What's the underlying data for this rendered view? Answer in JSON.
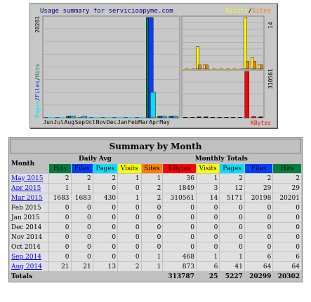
{
  "chart": {
    "title": "Usage summary for servicioapyme.com",
    "legend_visits": "Visits",
    "legend_sep": "/",
    "legend_sites": "Sites",
    "left_scale_max": "20201",
    "right_scale_max": "14",
    "right_lower_scale_max": "310561",
    "left_axis_pages": "Pages",
    "left_axis_files": "Files",
    "left_axis_hits": "Hits",
    "axis_sep": "/",
    "kbytes_label": "KBytes",
    "months": [
      "Jun",
      "Jul",
      "Aug",
      "Sep",
      "Oct",
      "Nov",
      "Dec",
      "Jan",
      "Feb",
      "Mar",
      "Apr",
      "May"
    ],
    "colors": {
      "hits": "#008040",
      "files": "#0040ff",
      "pages": "#00e0ff",
      "visits": "#ffff00",
      "sites": "#ff8000",
      "kbytes": "#ff0000"
    }
  },
  "chart_data": {
    "type": "bar",
    "title": "Usage summary for servicioapyme.com",
    "categories": [
      "Jun",
      "Jul",
      "Aug",
      "Sep",
      "Oct",
      "Nov",
      "Dec",
      "Jan",
      "Feb",
      "Mar",
      "Apr",
      "May"
    ],
    "series": [
      {
        "name": "Hits",
        "values": [
          0,
          0,
          6,
          0,
          0,
          0,
          0,
          0,
          0,
          20201,
          29,
          2
        ]
      },
      {
        "name": "Files",
        "values": [
          0,
          0,
          6,
          0,
          0,
          0,
          0,
          0,
          0,
          20198,
          29,
          2
        ]
      },
      {
        "name": "Pages",
        "values": [
          0,
          0,
          6,
          1,
          0,
          0,
          0,
          0,
          0,
          5171,
          12,
          2
        ]
      },
      {
        "name": "Visits",
        "values": [
          0,
          0,
          6,
          1,
          0,
          0,
          0,
          0,
          0,
          14,
          3,
          1
        ]
      },
      {
        "name": "Sites",
        "values": [
          0,
          0,
          1,
          1,
          0,
          0,
          0,
          0,
          0,
          2,
          2,
          1
        ]
      },
      {
        "name": "KBytes",
        "values": [
          0,
          0,
          873,
          468,
          0,
          0,
          0,
          0,
          0,
          310561,
          1849,
          36
        ]
      }
    ],
    "ylim_hits": [
      0,
      20201
    ],
    "ylim_visits": [
      0,
      14
    ],
    "ylim_kbytes": [
      0,
      310561
    ]
  },
  "table": {
    "title": "Summary by Month",
    "month_header": "Month",
    "daily_avg_header": "Daily Avg",
    "monthly_totals_header": "Monthly Totals",
    "daily_cols": [
      {
        "label": "Hits",
        "color": "#008040"
      },
      {
        "label": "Files",
        "color": "#0040ff"
      },
      {
        "label": "Pages",
        "color": "#00e0ff"
      },
      {
        "label": "Visits",
        "color": "#ffff00"
      }
    ],
    "monthly_cols": [
      {
        "label": "Sites",
        "color": "#ff8000"
      },
      {
        "label": "KBytes",
        "color": "#ff0000"
      },
      {
        "label": "Visits",
        "color": "#ffff00"
      },
      {
        "label": "Pages",
        "color": "#00e0ff"
      },
      {
        "label": "Files",
        "color": "#0040ff"
      },
      {
        "label": "Hits",
        "color": "#008040"
      }
    ],
    "rows": [
      {
        "month": "May 2015",
        "link": true,
        "v": [
          "2",
          "2",
          "2",
          "1",
          "1",
          "36",
          "1",
          "2",
          "2",
          "2"
        ]
      },
      {
        "month": "Apr 2015",
        "link": true,
        "v": [
          "1",
          "1",
          "0",
          "0",
          "2",
          "1849",
          "3",
          "12",
          "29",
          "29"
        ]
      },
      {
        "month": "Mar 2015",
        "link": true,
        "v": [
          "1683",
          "1683",
          "430",
          "1",
          "2",
          "310561",
          "14",
          "5171",
          "20198",
          "20201"
        ]
      },
      {
        "month": "Feb 2015",
        "link": false,
        "v": [
          "0",
          "0",
          "0",
          "0",
          "0",
          "0",
          "0",
          "0",
          "0",
          "0"
        ]
      },
      {
        "month": "Jan 2015",
        "link": false,
        "v": [
          "0",
          "0",
          "0",
          "0",
          "0",
          "0",
          "0",
          "0",
          "0",
          "0"
        ]
      },
      {
        "month": "Dec 2014",
        "link": false,
        "v": [
          "0",
          "0",
          "0",
          "0",
          "0",
          "0",
          "0",
          "0",
          "0",
          "0"
        ]
      },
      {
        "month": "Nov 2014",
        "link": false,
        "v": [
          "0",
          "0",
          "0",
          "0",
          "0",
          "0",
          "0",
          "0",
          "0",
          "0"
        ]
      },
      {
        "month": "Oct 2014",
        "link": false,
        "v": [
          "0",
          "0",
          "0",
          "0",
          "0",
          "0",
          "0",
          "0",
          "0",
          "0"
        ]
      },
      {
        "month": "Sep 2014",
        "link": true,
        "v": [
          "0",
          "0",
          "0",
          "0",
          "1",
          "468",
          "1",
          "1",
          "6",
          "6"
        ]
      },
      {
        "month": "Aug 2014",
        "link": true,
        "v": [
          "21",
          "21",
          "13",
          "2",
          "1",
          "873",
          "6",
          "41",
          "64",
          "64"
        ]
      }
    ],
    "totals_label": "Totals",
    "totals": [
      "313787",
      "25",
      "5227",
      "20299",
      "20302"
    ]
  }
}
